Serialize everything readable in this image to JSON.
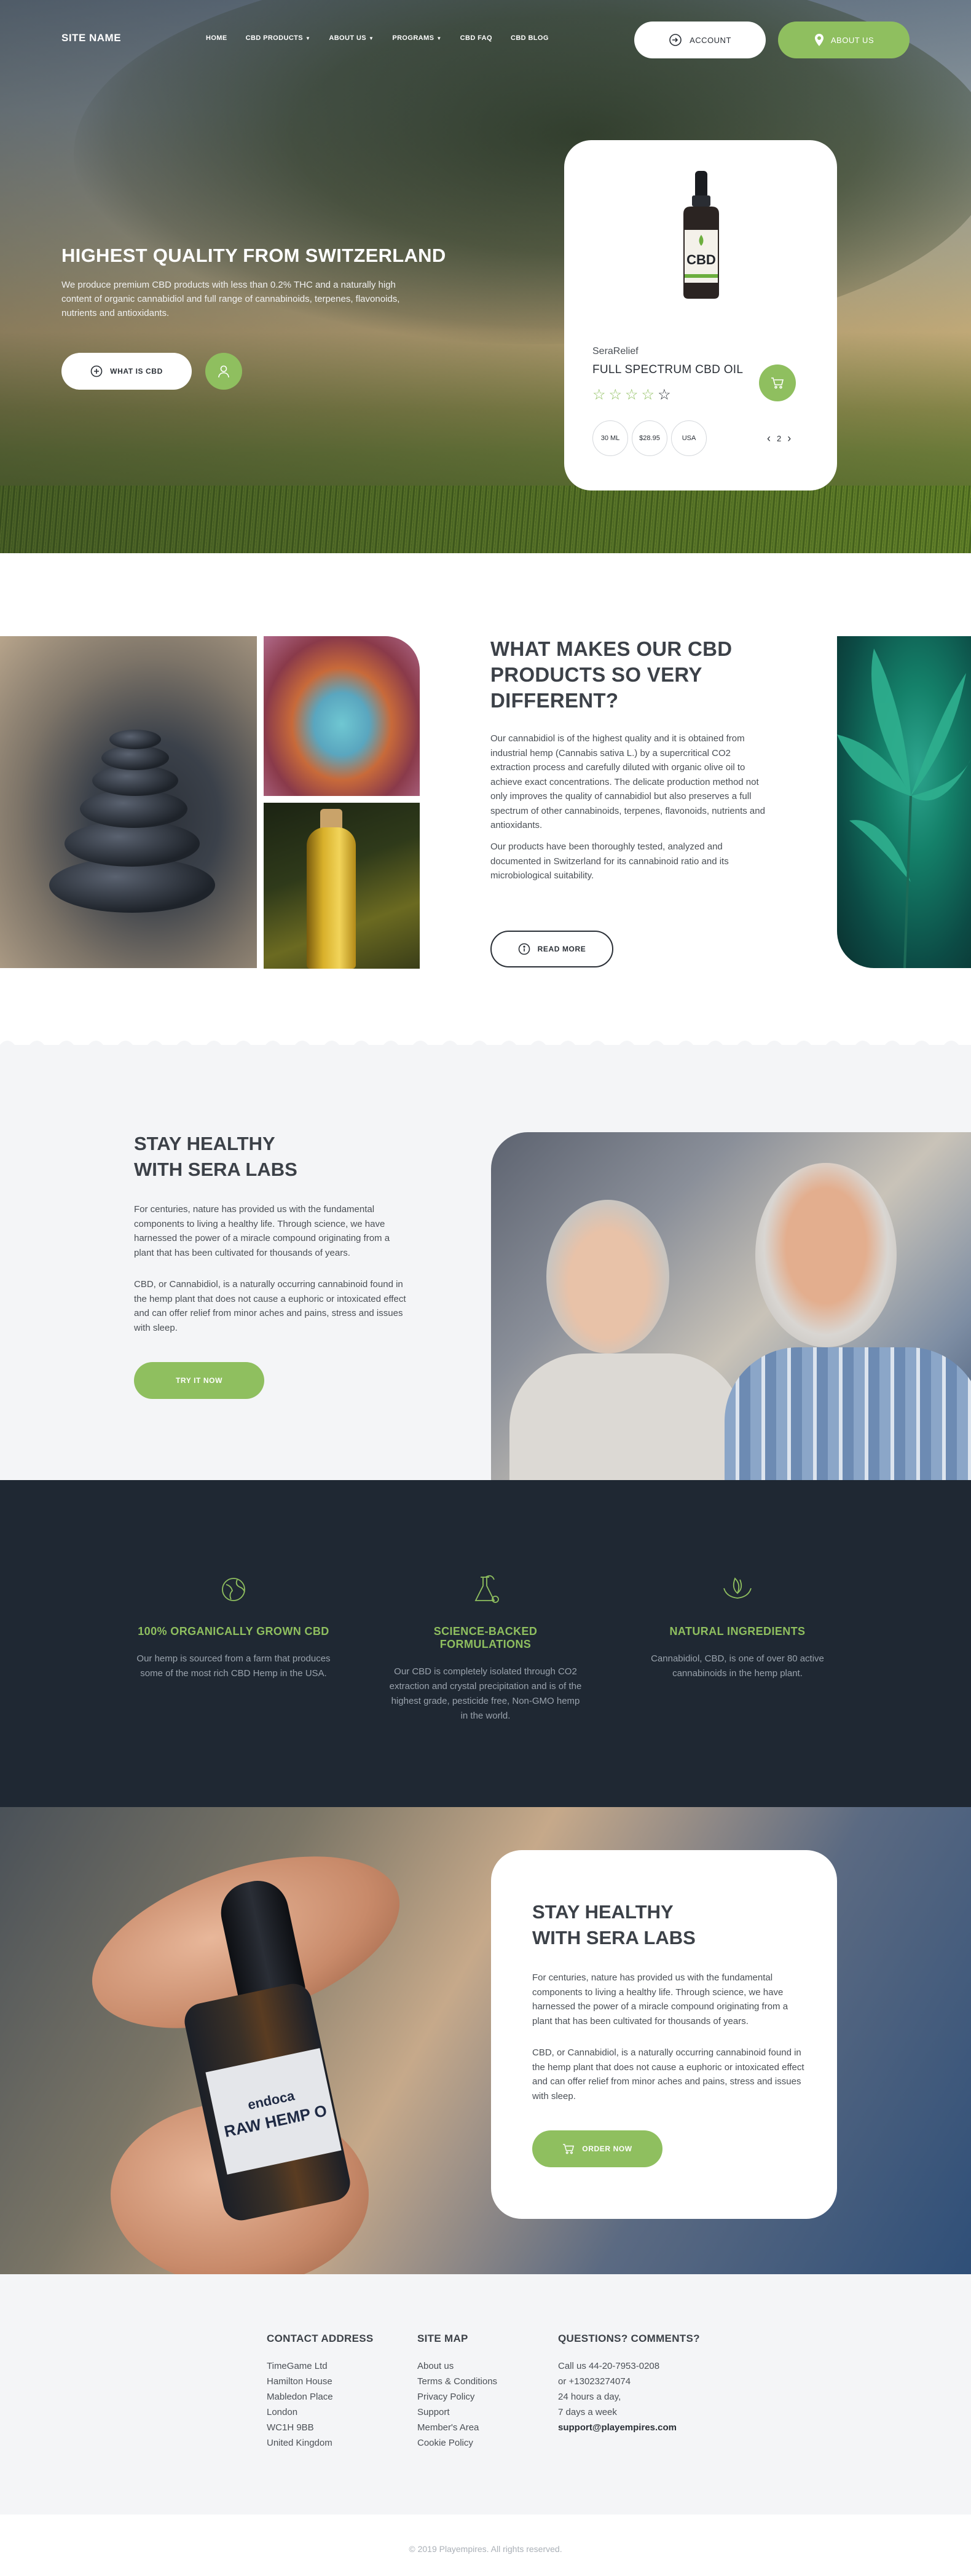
{
  "header": {
    "site_name": "SITE NAME",
    "menu": [
      {
        "label": "HOME",
        "has_dropdown": false
      },
      {
        "label": "CBD PRODUCTS",
        "has_dropdown": true
      },
      {
        "label": "ABOUT US",
        "has_dropdown": true
      },
      {
        "label": "PROGRAMS",
        "has_dropdown": true
      },
      {
        "label": "CBD FAQ",
        "has_dropdown": false
      },
      {
        "label": "CBD BLOG",
        "has_dropdown": false
      }
    ],
    "account_label": "ACCOUNT",
    "about_label": "ABOUT US"
  },
  "hero": {
    "title": "HIGHEST QUALITY FROM SWITZERLAND",
    "text": "We produce premium CBD products with less than 0.2% THC and a naturally high content of organic cannabidiol and full range of cannabinoids, terpenes, flavonoids, nutrients and antioxidants.",
    "what_button": "WHAT IS CBD"
  },
  "product": {
    "bottle_text": "CBD",
    "brand": "SeraRelief",
    "name": "FULL SPECTRUM CBD OIL",
    "rating": 4,
    "rating_max": 5,
    "options": [
      "30 ML",
      "$28.95",
      "USA"
    ],
    "page": "2"
  },
  "section_different": {
    "title": "WHAT MAKES OUR CBD PRODUCTS SO VERY DIFFERENT?",
    "p1": "Our cannabidiol is of the highest quality and it is obtained from industrial hemp (Cannabis sativa L.) by a supercritical CO2 extraction process and carefully diluted with organic olive oil to achieve exact concentrations. The delicate production method not only improves the quality of cannabidiol but also preserves a full spectrum of other cannabinoids, terpenes, flavonoids, nutrients and antioxidants.",
    "p2": "Our products have been thoroughly tested, analyzed and documented in Switzerland for its cannabinoid ratio and its microbiological suitability.",
    "read_more": "READ MORE"
  },
  "section_healthy": {
    "title_line1": "STAY HEALTHY",
    "title_line2": "WITH SERA LABS",
    "p1": "For centuries, nature has provided us with the fundamental components to living a healthy life. Through science, we have harnessed the power of a miracle compound originating from a plant that has been cultivated for thousands of years.",
    "p2": "CBD, or Cannabidiol, is a naturally occurring cannabinoid found in the hemp plant that does not cause a euphoric or intoxicated effect and can offer relief from minor aches and pains, stress and issues with sleep.",
    "try_button": "TRY IT NOW"
  },
  "features": [
    {
      "icon": "globe-leaf-icon",
      "title": "100% ORGANICALLY GROWN CBD",
      "text": "Our hemp is sourced from a farm that produces some of the most rich CBD Hemp in the USA."
    },
    {
      "icon": "flask-leaf-icon",
      "title": "SCIENCE-BACKED FORMULATIONS",
      "text": "Our CBD is completely isolated through CO2 extraction and crystal precipitation and is of the highest grade, pesticide free, Non-GMO hemp in the world."
    },
    {
      "icon": "hands-leaf-icon",
      "title": "NATURAL INGREDIENTS",
      "text": "Cannabidiol, CBD, is one of over 80 active cannabinoids in the hemp plant."
    }
  ],
  "section_order": {
    "title_line1": "STAY HEALTHY",
    "title_line2": "WITH SERA LABS",
    "p1": "For centuries, nature has provided us with the fundamental components to living a healthy life. Through science, we have harnessed the power of a miracle compound originating from a plant that has been cultivated for thousands of years.",
    "p2": "CBD, or Cannabidiol, is a naturally occurring cannabinoid found in the hemp plant that does not cause a euphoric or intoxicated effect and can offer relief from minor aches and pains, stress and issues with sleep.",
    "order_button": "ORDER NOW",
    "bottle_label_1": "endoca",
    "bottle_label_2": "RAW HEMP O"
  },
  "footer": {
    "contact_title": "CONTACT ADDRESS",
    "contact_lines": [
      "TimeGame Ltd",
      "Hamilton House",
      "Mabledon Place",
      "London",
      "WC1H 9BB",
      "United Kingdom"
    ],
    "sitemap_title": "SITE MAP",
    "sitemap_links": [
      "About us",
      "Terms & Conditions",
      "Privacy Policy",
      "Support",
      "Member's Area",
      "Cookie Policy"
    ],
    "questions_title": "QUESTIONS? COMMENTS?",
    "questions_lines": [
      "Call us 44-20-7953-0208",
      "or +13023274074",
      "24 hours a day,",
      "7 days a week"
    ],
    "email": "support@playempires.com",
    "copyright": "© 2019 Playempires. All rights reserved."
  },
  "colors": {
    "accent_green": "#8fbf5f",
    "dark_navy": "#1f2833",
    "light_gray_bg": "#f4f5f7"
  }
}
